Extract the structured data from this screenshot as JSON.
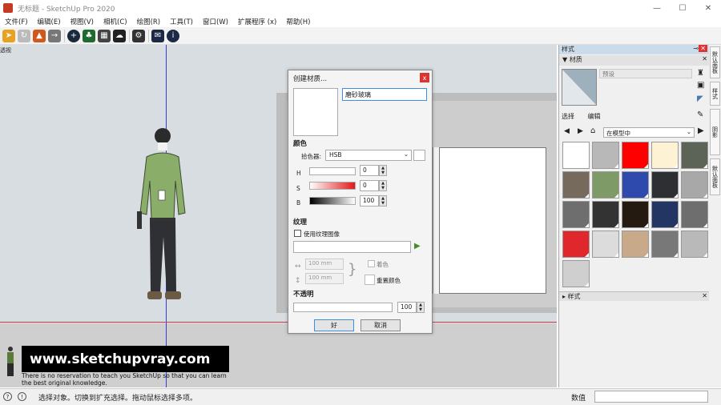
{
  "window": {
    "title": "无标题 - SketchUp Pro 2020",
    "minimize": "—",
    "maximize": "☐",
    "close": "✕"
  },
  "menu": [
    "文件(F)",
    "编辑(E)",
    "视图(V)",
    "相机(C)",
    "绘图(R)",
    "工具(T)",
    "窗口(W)",
    "扩展程序 (x)",
    "帮助(H)"
  ],
  "viewport": {
    "label": "透视"
  },
  "watermark": {
    "url": "www.sketchupvray.com",
    "line1": "There is no reservation to teach you SketchUp so that you can learn",
    "line2": "the best original knowledge."
  },
  "dialog": {
    "title": "创建材质...",
    "close": "x",
    "name_value": "磨砂玻璃",
    "color_section": "颜色",
    "picker_label": "拾色器:",
    "picker_value": "HSB",
    "h_label": "H",
    "s_label": "S",
    "b_label": "B",
    "h_value": "0",
    "s_value": "0",
    "b_value": "100",
    "texture_section": "纹理",
    "use_texture": "使用纹理图像",
    "width_placeholder": "100 mm",
    "height_placeholder": "100 mm",
    "colorize": "着色",
    "reset_color": "重置颜色",
    "opacity_section": "不透明",
    "opacity_value": "100",
    "ok": "好",
    "cancel": "取消"
  },
  "tray": {
    "title": "样式",
    "materials_header": "▼ 材质",
    "material_name": "预设",
    "tab_select": "选择",
    "tab_edit": "编辑",
    "location": "在模型中",
    "styles_header": "▸ 样式",
    "swatches": [
      "#ffffff",
      "#b8b8b8",
      "#ff0000",
      "#fdf3d4",
      "#5c6357",
      "#756a5b",
      "#7e9a66",
      "#2f4aad",
      "#2d2f33",
      "#a8a8a8",
      "#6e6e6e",
      "#333333",
      "#241a10",
      "#233562",
      "#6e6e6e",
      "#e0272c",
      "#dcdcdc",
      "#c8a989",
      "#787878",
      "#b9b9b9",
      "#cfcfcf"
    ]
  },
  "side_tabs": [
    "默认面板",
    "样式",
    "阴影",
    "默认面板"
  ],
  "status": {
    "text": "选择对象。切换到扩充选择。拖动鼠标选择多项。",
    "measure_label": "数值"
  }
}
